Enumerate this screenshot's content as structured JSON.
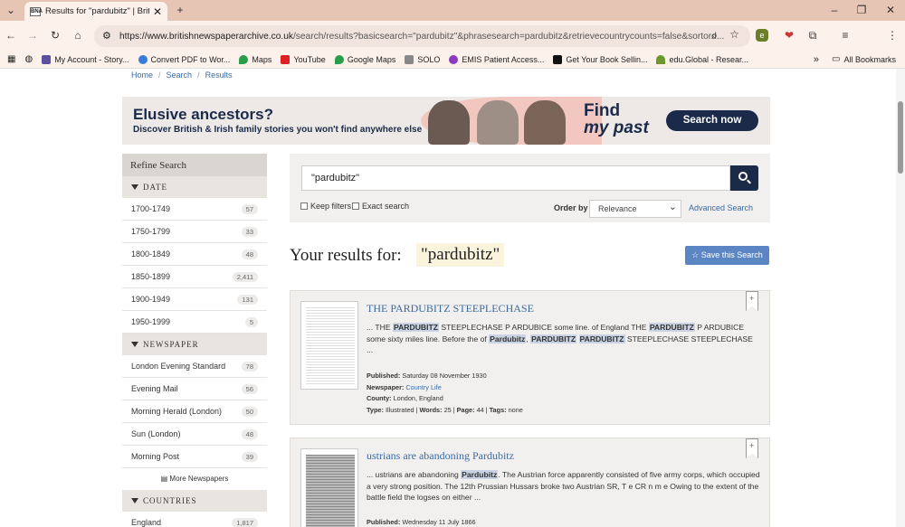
{
  "browser": {
    "tab_title": "Results for \"pardubitz\" | British",
    "favicon_text": "BNA",
    "url_host": "https://www.britishnewspaperarchive.co.uk",
    "url_path": "/search/results?basicsearch=\"pardubitz\"&phrasesearch=pardubitz&retrievecountrycounts=false&sortord...",
    "bookmarks": [
      "My Account - Story...",
      "Convert PDF to Wor...",
      "Maps",
      "YouTube",
      "Google Maps",
      "SOLO",
      "EMIS Patient Access...",
      "Get Your Book Sellin...",
      "edu.Global - Resear..."
    ],
    "all_bookmarks": "All Bookmarks"
  },
  "breadcrumb": [
    "Home",
    "Search",
    "Results"
  ],
  "banner": {
    "headline": "Elusive ancestors?",
    "subline": "Discover British & Irish family stories you won't find anywhere else",
    "brand_line1": "Find",
    "brand_line2": "my past",
    "cta": "Search now"
  },
  "sidebar": {
    "title": "Refine Search",
    "date_heading": "DATE",
    "dates": [
      {
        "label": "1700-1749",
        "count": "57"
      },
      {
        "label": "1750-1799",
        "count": "33"
      },
      {
        "label": "1800-1849",
        "count": "48"
      },
      {
        "label": "1850-1899",
        "count": "2,411"
      },
      {
        "label": "1900-1949",
        "count": "131"
      },
      {
        "label": "1950-1999",
        "count": "5"
      }
    ],
    "newspaper_heading": "NEWSPAPER",
    "newspapers": [
      {
        "label": "London Evening Standard",
        "count": "78"
      },
      {
        "label": "Evening Mail",
        "count": "56"
      },
      {
        "label": "Morning Herald (London)",
        "count": "50"
      },
      {
        "label": "Sun (London)",
        "count": "48"
      },
      {
        "label": "Morning Post",
        "count": "39"
      }
    ],
    "more_newspapers": "More Newspapers",
    "countries_heading": "COUNTRIES",
    "countries": [
      {
        "label": "England",
        "count": "1,817"
      }
    ]
  },
  "search": {
    "value": "\"pardubitz\"",
    "keep_filters": "Keep filters",
    "exact_search": "Exact search",
    "order_label": "Order by",
    "order_value": "Relevance",
    "advanced": "Advanced Search"
  },
  "results_heading": "Your results for:",
  "results_term": "\"pardubitz\"",
  "save_search": "Save this Search",
  "results": [
    {
      "title": "THE PARDUBITZ STEEPLECHASE",
      "published_label": "Published:",
      "published": "Saturday 08 November 1930",
      "newspaper_label": "Newspaper:",
      "newspaper": "Country Life",
      "county_label": "County:",
      "county": "London, England",
      "type_label": "Type:",
      "type": "Illustrated",
      "words_label": "Words:",
      "words": "25",
      "page_label": "Page:",
      "page": "44",
      "tags_label": "Tags:",
      "tags": "none"
    },
    {
      "title": "ustrians are abandoning Pardubitz",
      "published_label": "Published:",
      "published": "Wednesday 11 July 1866"
    }
  ],
  "colors": {
    "navy": "#1c2a4a",
    "link": "#3b6aa3",
    "save": "#5b86c3",
    "tab_bg": "#e6c5b5"
  }
}
